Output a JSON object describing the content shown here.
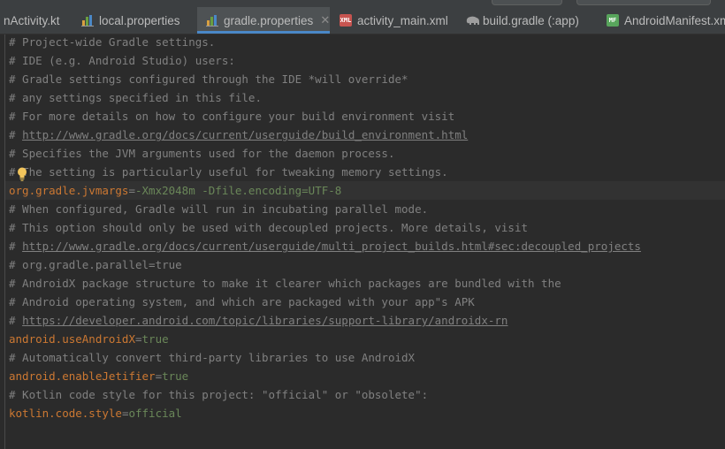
{
  "tabs": [
    {
      "label": "nActivity.kt",
      "icon": "kotlin-file-icon",
      "active": false
    },
    {
      "label": "local.properties",
      "icon": "properties-file-icon",
      "active": false
    },
    {
      "label": "gradle.properties",
      "icon": "properties-file-icon",
      "active": true
    },
    {
      "label": "activity_main.xml",
      "icon": "xml-layout-file-icon",
      "active": false
    },
    {
      "label": "build.gradle (:app)",
      "icon": "gradle-elephant-icon",
      "active": false
    },
    {
      "label": "AndroidManifest.xml",
      "icon": "manifest-file-icon",
      "active": false
    }
  ],
  "tab_icon_text": {
    "xml": "XML",
    "manifest": "MF"
  },
  "code": [
    {
      "type": "comment",
      "text": "# Project-wide Gradle settings."
    },
    {
      "type": "comment",
      "text": "# IDE (e.g. Android Studio) users:"
    },
    {
      "type": "comment",
      "text": "# Gradle settings configured through the IDE *will override*"
    },
    {
      "type": "comment",
      "text": "# any settings specified in this file."
    },
    {
      "type": "comment",
      "text": "# For more details on how to configure your build environment visit"
    },
    {
      "type": "link",
      "prefix": "# ",
      "text": "http://www.gradle.org/docs/current/userguide/build_environment.html"
    },
    {
      "type": "comment",
      "text": "# Specifies the JVM arguments used for the daemon process."
    },
    {
      "type": "comment",
      "text": "# The setting is particularly useful for tweaking memory settings."
    },
    {
      "type": "property",
      "key": "org.gradle.jvmargs",
      "sep": "=",
      "value": "-Xmx2048m -Dfile.encoding=UTF-8",
      "current": true
    },
    {
      "type": "comment",
      "text": "# When configured, Gradle will run in incubating parallel mode."
    },
    {
      "type": "comment",
      "text": "# This option should only be used with decoupled projects. More details, visit"
    },
    {
      "type": "link",
      "prefix": "# ",
      "text": "http://www.gradle.org/docs/current/userguide/multi_project_builds.html#sec:decoupled_projects"
    },
    {
      "type": "comment",
      "text": "# org.gradle.parallel=true"
    },
    {
      "type": "comment",
      "text": "# AndroidX package structure to make it clearer which packages are bundled with the"
    },
    {
      "type": "comment",
      "text": "# Android operating system, and which are packaged with your app\"s APK"
    },
    {
      "type": "link",
      "prefix": "# ",
      "text": "https://developer.android.com/topic/libraries/support-library/androidx-rn"
    },
    {
      "type": "property",
      "key": "android.useAndroidX",
      "sep": "=",
      "value": "true"
    },
    {
      "type": "comment",
      "text": "# Automatically convert third-party libraries to use AndroidX"
    },
    {
      "type": "property",
      "key": "android.enableJetifier",
      "sep": "=",
      "value": "true"
    },
    {
      "type": "comment",
      "text": "# Kotlin code style for this project: \"official\" or \"obsolete\":"
    },
    {
      "type": "property",
      "key": "kotlin.code.style",
      "sep": "=",
      "value": "official"
    }
  ],
  "colors": {
    "editor_bg": "#2b2b2b",
    "comment": "#808080",
    "key": "#cc7832",
    "value": "#6a8759",
    "tab_active_underline": "#4a88c7",
    "current_line": "#323232"
  },
  "intention_icon": "lightbulb-icon"
}
